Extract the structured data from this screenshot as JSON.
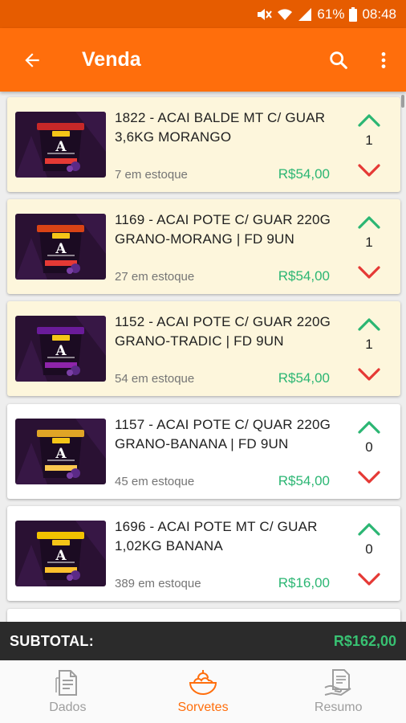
{
  "status_bar": {
    "battery": "61%",
    "time": "08:48"
  },
  "app_bar": {
    "title": "Venda",
    "back_icon": "arrow-left-icon",
    "search_icon": "search-icon",
    "menu_icon": "more-vert-icon"
  },
  "products": [
    {
      "name": "1822 - ACAI BALDE MT C/ GUAR 3,6KG MORANGO",
      "stock": "7 em estoque",
      "price": "R$54,00",
      "qty": "1",
      "selected": true,
      "lid_color": "#c62828",
      "label_color": "#e53935"
    },
    {
      "name": "1169 - ACAI POTE C/ GUAR 220G GRANO-MORANG | FD 9UN",
      "stock": "27 em estoque",
      "price": "R$54,00",
      "qty": "1",
      "selected": true,
      "lid_color": "#d84315",
      "label_color": "#e53935"
    },
    {
      "name": "1152 - ACAI POTE C/ GUAR 220G GRANO-TRADIC | FD 9UN",
      "stock": "54 em estoque",
      "price": "R$54,00",
      "qty": "1",
      "selected": true,
      "lid_color": "#6a1b9a",
      "label_color": "#8e24aa"
    },
    {
      "name": "1157 - ACAI POTE C/ QUAR 220G GRANO-BANANA | FD 9UN",
      "stock": "45 em estoque",
      "price": "R$54,00",
      "qty": "0",
      "selected": false,
      "lid_color": "#e0a526",
      "label_color": "#f9c74f"
    },
    {
      "name": "1696 - ACAI POTE MT C/ GUAR 1,02KG BANANA",
      "stock": "389 em estoque",
      "price": "R$16,00",
      "qty": "0",
      "selected": false,
      "lid_color": "#f2c200",
      "label_color": "#fbc02d"
    }
  ],
  "subtotal": {
    "label": "SUBTOTAL:",
    "value": "R$162,00"
  },
  "bottom_nav": [
    {
      "label": "Dados",
      "icon": "document-icon",
      "active": false
    },
    {
      "label": "Sorvetes",
      "icon": "ice-cream-bowl-icon",
      "active": true
    },
    {
      "label": "Resumo",
      "icon": "summary-icon",
      "active": false
    }
  ],
  "colors": {
    "primary": "#ff6e0c",
    "status_bar": "#e65c00",
    "up_arrow": "#2bb673",
    "down_arrow": "#e53935",
    "price": "#2bb673",
    "selected_card": "#fdf6dc"
  }
}
